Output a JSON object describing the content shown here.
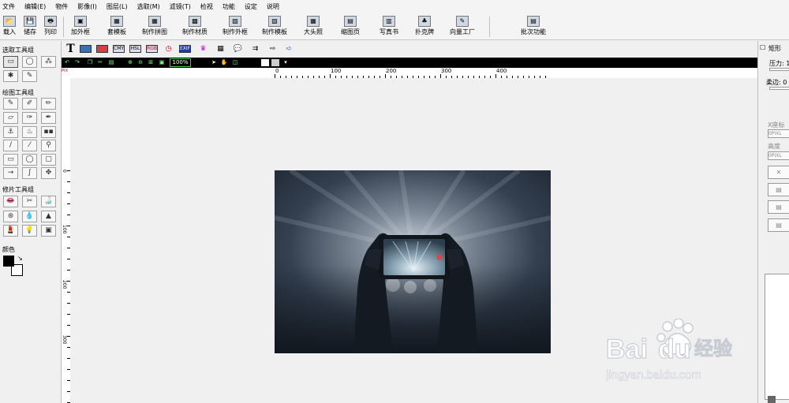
{
  "menu": [
    "文件",
    "编辑(E)",
    "物件",
    "影像(I)",
    "图层(L)",
    "选取(M)",
    "滤镜(T)",
    "检视",
    "功能",
    "设定",
    "说明"
  ],
  "toolbar": [
    {
      "label": "载入",
      "icon": "folder-open-icon"
    },
    {
      "label": "储存",
      "icon": "save-icon"
    },
    {
      "label": "列印",
      "icon": "printer-icon"
    },
    {
      "label": "加外框",
      "icon": "frame-icon"
    },
    {
      "label": "套模板",
      "icon": "template-icon"
    },
    {
      "label": "制作拼图",
      "icon": "collage-icon"
    },
    {
      "label": "制作材质",
      "icon": "texture-icon"
    },
    {
      "label": "制作外框",
      "icon": "make-frame-icon"
    },
    {
      "label": "制作模板",
      "icon": "make-template-icon"
    },
    {
      "label": "大头照",
      "icon": "id-photo-icon"
    },
    {
      "label": "缩图页",
      "icon": "thumbnail-page-icon"
    },
    {
      "label": "写真书",
      "icon": "photo-book-icon"
    },
    {
      "label": "扑克牌",
      "icon": "poker-cards-icon"
    },
    {
      "label": "向量工厂",
      "icon": "vector-factory-icon"
    },
    {
      "label": "批次功能",
      "icon": "batch-icon"
    }
  ],
  "left_panel": {
    "select_group": "选取工具组",
    "draw_group": "绘图工具组",
    "retouch_group": "修片工具组",
    "color_label": "颜色"
  },
  "tool_options": {
    "zoom": "100%",
    "text_tool": "T",
    "badges": [
      "CMY",
      "HSL",
      "RGB",
      "EXIF"
    ]
  },
  "ruler": {
    "top": [
      "0",
      "100",
      "200",
      "300",
      "400"
    ],
    "left": [
      "0",
      "100",
      "200",
      "300"
    ]
  },
  "right_panel": {
    "rect": "矩形",
    "pressure": "压力: 1",
    "soft": "柔边: 0",
    "x": "X座标",
    "height": "高度",
    "unit": "0PIXL",
    "unit2": "0PIXL"
  },
  "watermark": {
    "brand": "Bai",
    "brand2": "du",
    "cn": "经验",
    "url": "jingyan.baidu.com"
  },
  "colors": {
    "fg": "#000000",
    "bg": "#ffffff"
  }
}
